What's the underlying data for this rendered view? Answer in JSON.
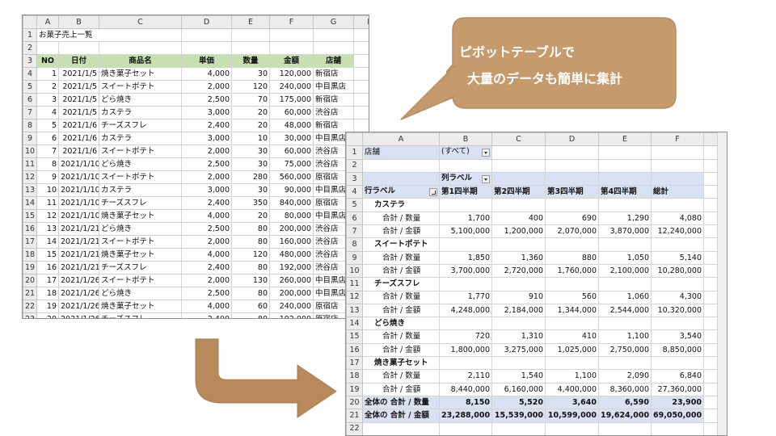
{
  "colors": {
    "header_green": "#c6e0b4",
    "pivot_band": "#d9e1f2",
    "callout": "#c59a6d",
    "arrow": "#b8895b"
  },
  "callout": {
    "line1": "ピボットテーブルで",
    "line2": "大量のデータも簡単に集計"
  },
  "sheet1": {
    "columns": [
      "A",
      "B",
      "C",
      "D",
      "E",
      "F",
      "G",
      "H"
    ],
    "title": "お菓子売上一覧",
    "headers": [
      "NO",
      "日付",
      "商品名",
      "単価",
      "数量",
      "金額",
      "店舗"
    ],
    "rows": [
      [
        "1",
        "2021/1/5",
        "焼き菓子セット",
        "4,000",
        "30",
        "120,000",
        "新宿店"
      ],
      [
        "2",
        "2021/1/5",
        "スイートポテト",
        "2,000",
        "120",
        "240,000",
        "中目黒店"
      ],
      [
        "3",
        "2021/1/5",
        "どら焼き",
        "2,500",
        "70",
        "175,000",
        "新宿店"
      ],
      [
        "4",
        "2021/1/5",
        "カステラ",
        "3,000",
        "20",
        "60,000",
        "渋谷店"
      ],
      [
        "5",
        "2021/1/6",
        "チーズスフレ",
        "2,400",
        "20",
        "48,000",
        "新宿店"
      ],
      [
        "6",
        "2021/1/6",
        "カステラ",
        "3,000",
        "10",
        "30,000",
        "中目黒店"
      ],
      [
        "7",
        "2021/1/6",
        "スイートポテト",
        "2,000",
        "30",
        "60,000",
        "渋谷店"
      ],
      [
        "8",
        "2021/1/10",
        "どら焼き",
        "2,500",
        "30",
        "75,000",
        "渋谷店"
      ],
      [
        "9",
        "2021/1/10",
        "スイートポテト",
        "2,000",
        "280",
        "560,000",
        "原宿店"
      ],
      [
        "10",
        "2021/1/10",
        "カステラ",
        "3,000",
        "30",
        "90,000",
        "中目黒店"
      ],
      [
        "11",
        "2021/1/10",
        "チーズスフレ",
        "2,400",
        "350",
        "840,000",
        "原宿店"
      ],
      [
        "12",
        "2021/1/10",
        "焼き菓子セット",
        "4,000",
        "20",
        "80,000",
        "中目黒店"
      ],
      [
        "13",
        "2021/1/21",
        "どら焼き",
        "2,500",
        "80",
        "200,000",
        "渋谷店"
      ],
      [
        "14",
        "2021/1/21",
        "スイートポテト",
        "2,000",
        "80",
        "160,000",
        "渋谷店"
      ],
      [
        "15",
        "2021/1/21",
        "焼き菓子セット",
        "4,000",
        "120",
        "480,000",
        "渋谷店"
      ],
      [
        "16",
        "2021/1/21",
        "チーズスフレ",
        "2,400",
        "80",
        "192,000",
        "渋谷店"
      ],
      [
        "17",
        "2021/1/26",
        "スイートポテト",
        "2,000",
        "130",
        "260,000",
        "中目黒店"
      ],
      [
        "18",
        "2021/1/26",
        "どら焼き",
        "2,500",
        "80",
        "200,000",
        "中目黒店"
      ],
      [
        "19",
        "2021/1/26",
        "焼き菓子セット",
        "4,000",
        "60",
        "240,000",
        "原宿店"
      ],
      [
        "20",
        "2021/1/26",
        "チーズスフレ",
        "2,400",
        "80",
        "192,000",
        "原宿店"
      ]
    ]
  },
  "sheet2": {
    "columns": [
      "A",
      "B",
      "C",
      "D",
      "E",
      "F"
    ],
    "filter_label": "店舗",
    "filter_value": "(すべて)",
    "col_labels": "列ラベル",
    "row_labels": "行ラベル",
    "quarters": [
      "第1四半期",
      "第2四半期",
      "第3四半期",
      "第4四半期",
      "総計"
    ],
    "items": [
      {
        "name": "カステラ",
        "qty_label": "合計 / 数量",
        "qty": [
          "1,700",
          "400",
          "690",
          "1,290",
          "4,080"
        ],
        "amt_label": "合計 / 金額",
        "amt": [
          "5,100,000",
          "1,200,000",
          "2,070,000",
          "3,870,000",
          "12,240,000"
        ]
      },
      {
        "name": "スイートポテト",
        "qty_label": "合計 / 数量",
        "qty": [
          "1,850",
          "1,360",
          "880",
          "1,050",
          "5,140"
        ],
        "amt_label": "合計 / 金額",
        "amt": [
          "3,700,000",
          "2,720,000",
          "1,760,000",
          "2,100,000",
          "10,280,000"
        ]
      },
      {
        "name": "チーズスフレ",
        "qty_label": "合計 / 数量",
        "qty": [
          "1,770",
          "910",
          "560",
          "1,060",
          "4,300"
        ],
        "amt_label": "合計 / 金額",
        "amt": [
          "4,248,000",
          "2,184,000",
          "1,344,000",
          "2,544,000",
          "10,320,000"
        ]
      },
      {
        "name": "どら焼き",
        "qty_label": "合計 / 数量",
        "qty": [
          "720",
          "1,310",
          "410",
          "1,100",
          "3,540"
        ],
        "amt_label": "合計 / 金額",
        "amt": [
          "1,800,000",
          "3,275,000",
          "1,025,000",
          "2,750,000",
          "8,850,000"
        ]
      },
      {
        "name": "焼き菓子セット",
        "qty_label": "合計 / 数量",
        "qty": [
          "2,110",
          "1,540",
          "1,100",
          "2,090",
          "6,840"
        ],
        "amt_label": "合計 / 金額",
        "amt": [
          "8,440,000",
          "6,160,000",
          "4,400,000",
          "8,360,000",
          "27,360,000"
        ]
      }
    ],
    "total_qty_label": "全体の 合計 / 数量",
    "total_qty": [
      "8,150",
      "5,520",
      "3,640",
      "6,590",
      "23,900"
    ],
    "total_amt_label": "全体の 合計 / 金額",
    "total_amt": [
      "23,288,000",
      "15,539,000",
      "10,599,000",
      "19,624,000",
      "69,050,000"
    ]
  }
}
